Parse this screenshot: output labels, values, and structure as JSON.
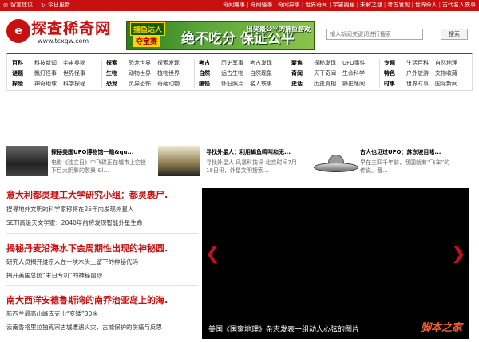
{
  "topbar": {
    "links_left": [
      "留言建议",
      "今日更新"
    ],
    "links_right": [
      "奇闻趣事",
      "奇闻怪事",
      "奇闻异事",
      "世界奇闻",
      "宇宙奥秘",
      "未解之谜",
      "考古发现",
      "世界奇人",
      "古代名人轶事"
    ]
  },
  "logo": {
    "name": "探查稀奇网",
    "url": "www.tcxqw.com",
    "mark": "e"
  },
  "banner": {
    "tag1": "捕鱼达人",
    "tag2": "夺宝赛",
    "slogan": "绝不吃分 保证公平",
    "side": "出奖最公平的捕鱼游戏"
  },
  "search": {
    "placeholder": "输入新闻关键词进行搜索",
    "button": "搜索"
  },
  "nav": {
    "groups": [
      {
        "rows": [
          {
            "cat": "百科",
            "links": [
              "科技新知",
              "宇宙奥秘"
            ]
          },
          {
            "cat": "谜题",
            "links": [
              "飘灯怪事",
              "世界怪事"
            ]
          },
          {
            "cat": "探险",
            "links": [
              "神奇地球",
              "科学探秘"
            ]
          }
        ]
      },
      {
        "rows": [
          {
            "cat": "探索",
            "links": [
              "恐龙世界",
              "探索发现"
            ]
          },
          {
            "cat": "生物",
            "links": [
              "动物世界",
              "植物世界"
            ]
          },
          {
            "cat": "恐龙",
            "links": [
              "灵异恐怖",
              "奇葩动物"
            ]
          }
        ]
      },
      {
        "rows": [
          {
            "cat": "考古",
            "links": [
              "历史军事",
              "考古发现"
            ]
          },
          {
            "cat": "自然",
            "links": [
              "远古生物",
              "自然现象"
            ]
          },
          {
            "cat": "编怪",
            "links": [
              "怀旧照片",
              "名人轶事"
            ]
          }
        ]
      },
      {
        "rows": [
          {
            "cat": "聚焦",
            "links": [
              "探秘发现",
              "UFO事件"
            ]
          },
          {
            "cat": "奇闻",
            "links": [
              "天下奇闻",
              "生命科学"
            ]
          },
          {
            "cat": "史话",
            "links": [
              "历史真相",
              "野史逸闻"
            ]
          }
        ]
      },
      {
        "rows": [
          {
            "cat": "专题",
            "links": [
              "生活百科",
              "自然地理"
            ]
          },
          {
            "cat": "特色",
            "links": [
              "户外旅游",
              "文物收藏"
            ]
          },
          {
            "cat": "时事",
            "links": [
              "世界时事",
              "国际新闻"
            ]
          }
        ]
      }
    ]
  },
  "thumbs": [
    {
      "title": "探秘美国UFO博物馆一瞧&qu...",
      "desc1": "电影《独立日》中飞碟正在城市上空投",
      "desc2": "下巨大阴影的製景 &l..."
    },
    {
      "title": "寻找外星人：利用蝎鱼鸣叫和无...",
      "desc1": "寻找外星人 风暴科技讯 北京时间7月",
      "desc2": "18日讯，外星文明搜索..."
    },
    {
      "title": "古人也见过UFO：苏东坡目睹...",
      "desc1": "早在三四千年前，我国就有“飞车”的",
      "desc2": "传说。晋..."
    }
  ],
  "headlines": [
    {
      "title": "意大利都灵理工大学研究小组：都灵裹尸.",
      "subs": [
        "搜寻地外文明的科学家称将在25年内发现外星人",
        "SETI高级天文学家：2040年前将发现智能外星生命"
      ]
    },
    {
      "title": "揭秘丹麦沿海水下会周期性出现的神秘圆.",
      "subs": [
        "研究人员揭开维京人在一块木头上留下的神秘代码",
        "揭开美国总统“末日专机”的神秘面纱"
      ]
    },
    {
      "title": "南大西洋安德鲁斯湾的南乔治亚岛上的海.",
      "subs": [
        "新西兰最高山峰库克山“变矮”30米",
        "云南香格里拉独克宗古城遭遇火灾，古城保护的伤痛与反思"
      ]
    }
  ],
  "slideshow": {
    "caption": "美国《国家地理》杂志发表一组动人心弦的图片",
    "watermark": "脚本之家"
  }
}
